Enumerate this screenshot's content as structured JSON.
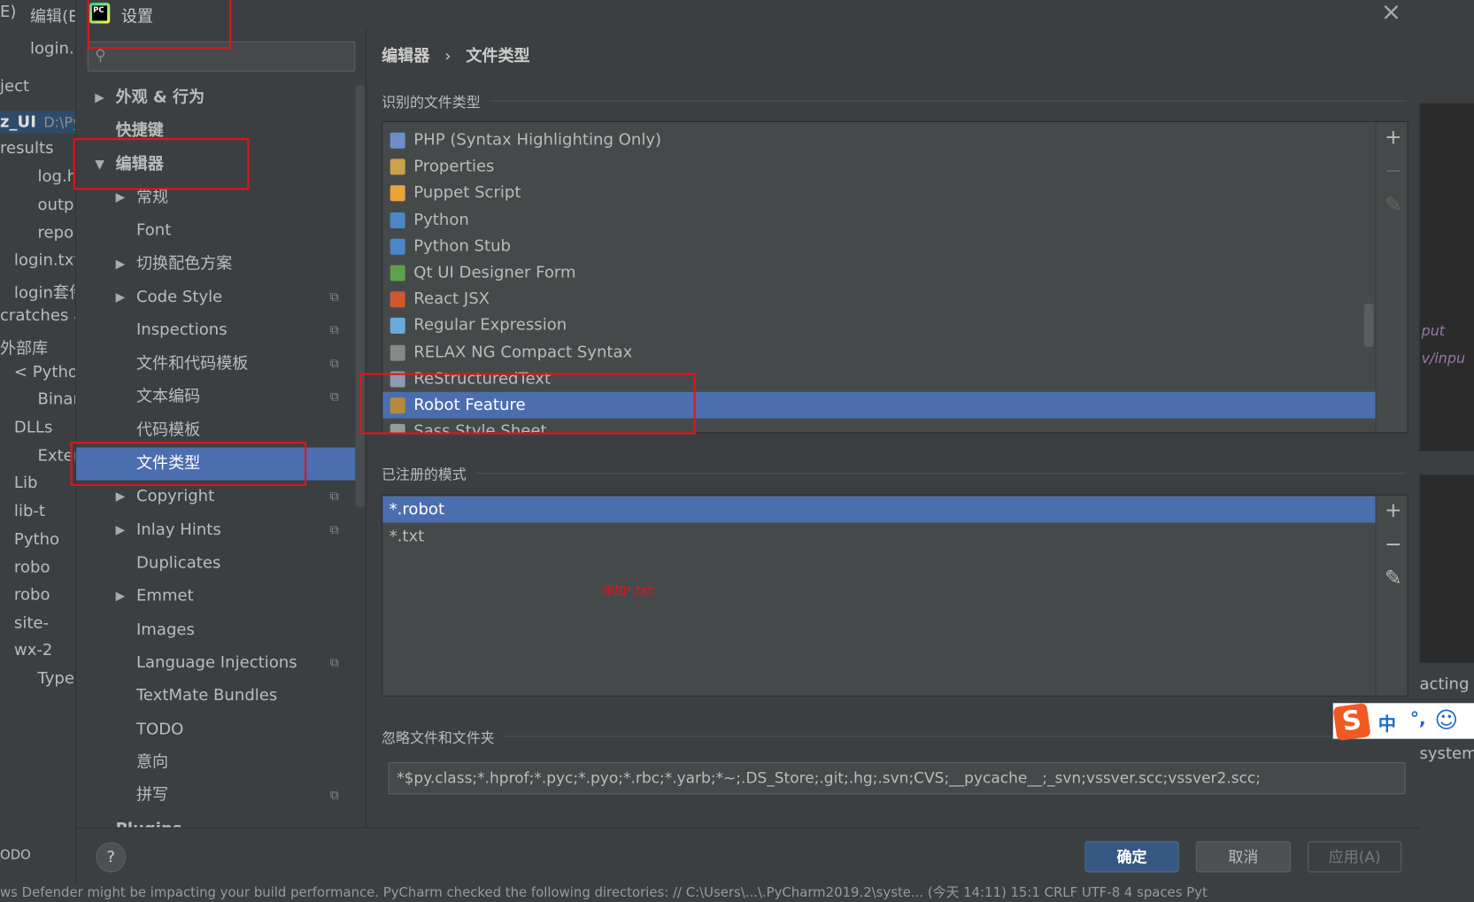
{
  "ide": {
    "menu": [
      "E)",
      "编辑(E"
    ],
    "tab": "login.",
    "project_dropdown": "ject",
    "project_root": "z_UI",
    "project_path": "D:\\Py",
    "tree": [
      "results",
      "log.h",
      "outp",
      "repo",
      "login.txt",
      "login套件",
      "cratches a",
      "外部库",
      "< Pytho",
      "Binar",
      "DLLs",
      "Exter",
      "Lib",
      "lib-t",
      "Pytho",
      "robo",
      "robo",
      "site-",
      "wx-2",
      "Type"
    ],
    "right_code": [
      "put",
      "v/inpu"
    ],
    "right_notice": [
      "acting y",
      "system"
    ],
    "bottom_tab": "ODO",
    "status_text": "ws Defender might be impacting your build performance. PyCharm checked the following directories: // C:\\Users\\...\\.PyCharm2019.2\\syste... (今天 14:11)   15:1   CRLF   UTF-8   4 spaces   Pyt"
  },
  "dialog": {
    "title": "设置",
    "close": "×",
    "search_placeholder": "",
    "tree": [
      {
        "label": "外观 & 行为",
        "arrow": "▶",
        "level": 0,
        "bold": true
      },
      {
        "label": "快捷键",
        "arrow": "",
        "level": 0,
        "bold": true
      },
      {
        "label": "编辑器",
        "arrow": "▼",
        "level": 0,
        "bold": true
      },
      {
        "label": "常规",
        "arrow": "▶",
        "level": 1
      },
      {
        "label": "Font",
        "arrow": "",
        "level": 1
      },
      {
        "label": "切换配色方案",
        "arrow": "▶",
        "level": 1
      },
      {
        "label": "Code Style",
        "arrow": "▶",
        "level": 1,
        "copy": true
      },
      {
        "label": "Inspections",
        "arrow": "",
        "level": 1,
        "copy": true
      },
      {
        "label": "文件和代码模板",
        "arrow": "",
        "level": 1,
        "copy": true
      },
      {
        "label": "文本编码",
        "arrow": "",
        "level": 1,
        "copy": true
      },
      {
        "label": "代码模板",
        "arrow": "",
        "level": 1
      },
      {
        "label": "文件类型",
        "arrow": "",
        "level": 1,
        "selected": true
      },
      {
        "label": "Copyright",
        "arrow": "▶",
        "level": 1,
        "copy": true
      },
      {
        "label": "Inlay Hints",
        "arrow": "▶",
        "level": 1,
        "copy": true
      },
      {
        "label": "Duplicates",
        "arrow": "",
        "level": 1
      },
      {
        "label": "Emmet",
        "arrow": "▶",
        "level": 1
      },
      {
        "label": "Images",
        "arrow": "",
        "level": 1
      },
      {
        "label": "Language Injections",
        "arrow": "",
        "level": 1,
        "copy": true
      },
      {
        "label": "TextMate Bundles",
        "arrow": "",
        "level": 1
      },
      {
        "label": "TODO",
        "arrow": "",
        "level": 1
      },
      {
        "label": "意向",
        "arrow": "",
        "level": 1
      },
      {
        "label": "拼写",
        "arrow": "",
        "level": 1,
        "copy": true
      },
      {
        "label": "Plugins",
        "arrow": "",
        "level": 0,
        "bold": true
      }
    ],
    "breadcrumb": [
      "编辑器",
      "文件类型"
    ],
    "breadcrumb_sep": "›",
    "recognized_label": "识别的文件类型",
    "file_types": [
      {
        "label": "PHP (Syntax Highlighting Only)",
        "color": "#6d8fc9"
      },
      {
        "label": "Properties",
        "color": "#c9a24b"
      },
      {
        "label": "Puppet Script",
        "color": "#e8a33b"
      },
      {
        "label": "Python",
        "color": "#4a88c7"
      },
      {
        "label": "Python Stub",
        "color": "#4a88c7"
      },
      {
        "label": "Qt UI Designer Form",
        "color": "#5fa04e"
      },
      {
        "label": "React JSX",
        "color": "#d0582f"
      },
      {
        "label": "Regular Expression",
        "color": "#6aa9d8"
      },
      {
        "label": "RELAX NG Compact Syntax",
        "color": "#888888"
      },
      {
        "label": "ReStructuredText",
        "color": "#8a9bb0"
      },
      {
        "label": "Robot Feature",
        "color": "#b58a3c",
        "selected": true
      },
      {
        "label": "Sass Style Sheet",
        "color": "#999999"
      }
    ],
    "patterns_label": "已注册的模式",
    "patterns": [
      {
        "label": "*.robot",
        "selected": true
      },
      {
        "label": "*.txt"
      }
    ],
    "annotation": "添加*.txt",
    "ignore_label": "忽略文件和文件夹",
    "ignore_value": "*$py.class;*.hprof;*.pyc;*.pyo;*.rbc;*.yarb;*~;.DS_Store;.git;.hg;.svn;CVS;__pycache__;_svn;vssver.scc;vssver2.scc;",
    "tools": {
      "add": "+",
      "remove": "−",
      "edit": "✎"
    },
    "help": "?",
    "ok": "确定",
    "cancel": "取消",
    "apply": "应用(A)"
  },
  "ime": {
    "logo": "S",
    "mode": "中",
    "punct": "°,",
    "emoji": "☺"
  },
  "colors": {
    "selection": "#4b6eaf",
    "highlight_box": "#e0151d",
    "primary_button": "#365880"
  }
}
